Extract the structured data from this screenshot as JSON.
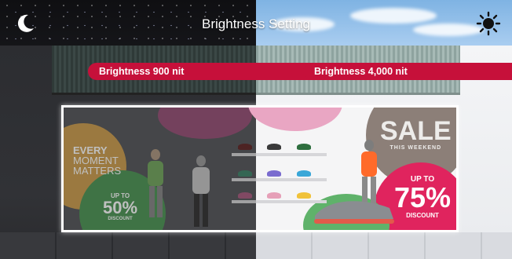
{
  "header": {
    "title": "Brightness Setting",
    "left_icon": "moon-icon",
    "right_icon": "sun-icon"
  },
  "comparison": {
    "left_label": "Brightness 900 nit",
    "right_label": "Brightness 4,000 nit"
  },
  "display_content": {
    "tagline_lines": [
      "EVERY",
      "MOMENT",
      "MATTERS"
    ],
    "left_promo_top": "UP TO",
    "left_promo_value": "50%",
    "left_promo_bottom": "DISCOUNT",
    "sale_title": "SALE",
    "sale_subtitle": "THIS WEEKEND",
    "right_promo_top": "UP TO",
    "right_promo_value": "75%",
    "right_promo_bottom": "DISCOUNT"
  },
  "colors": {
    "pill": "#c6103a",
    "promo_pink": "#e0245e",
    "promo_green": "#3ea14a"
  }
}
